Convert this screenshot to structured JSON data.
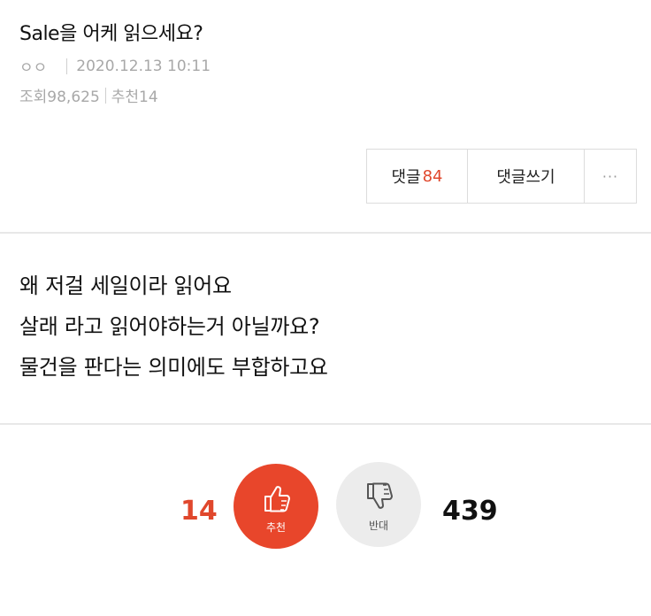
{
  "post": {
    "title": "Sale을 어케 읽으세요?",
    "author": "ㅇㅇ",
    "datetime": "2020.12.13 10:11",
    "views": "조회98,625",
    "recommend": "추천14"
  },
  "actions": {
    "comments_label": "댓글",
    "comments_count": "84",
    "write_comment_label": "댓글쓰기",
    "more_label": "···"
  },
  "body": {
    "lines": [
      "왜 저걸 세일이라 읽어요",
      "살래 라고 읽어야하는거 아닐까요?",
      "물건을 판다는 의미에도 부합하고요"
    ]
  },
  "vote": {
    "recommend_count": "14",
    "recommend_label": "추천",
    "oppose_label": "반대",
    "oppose_count": "439",
    "recommend_color": "#e8462b",
    "oppose_color": "#ececec"
  }
}
